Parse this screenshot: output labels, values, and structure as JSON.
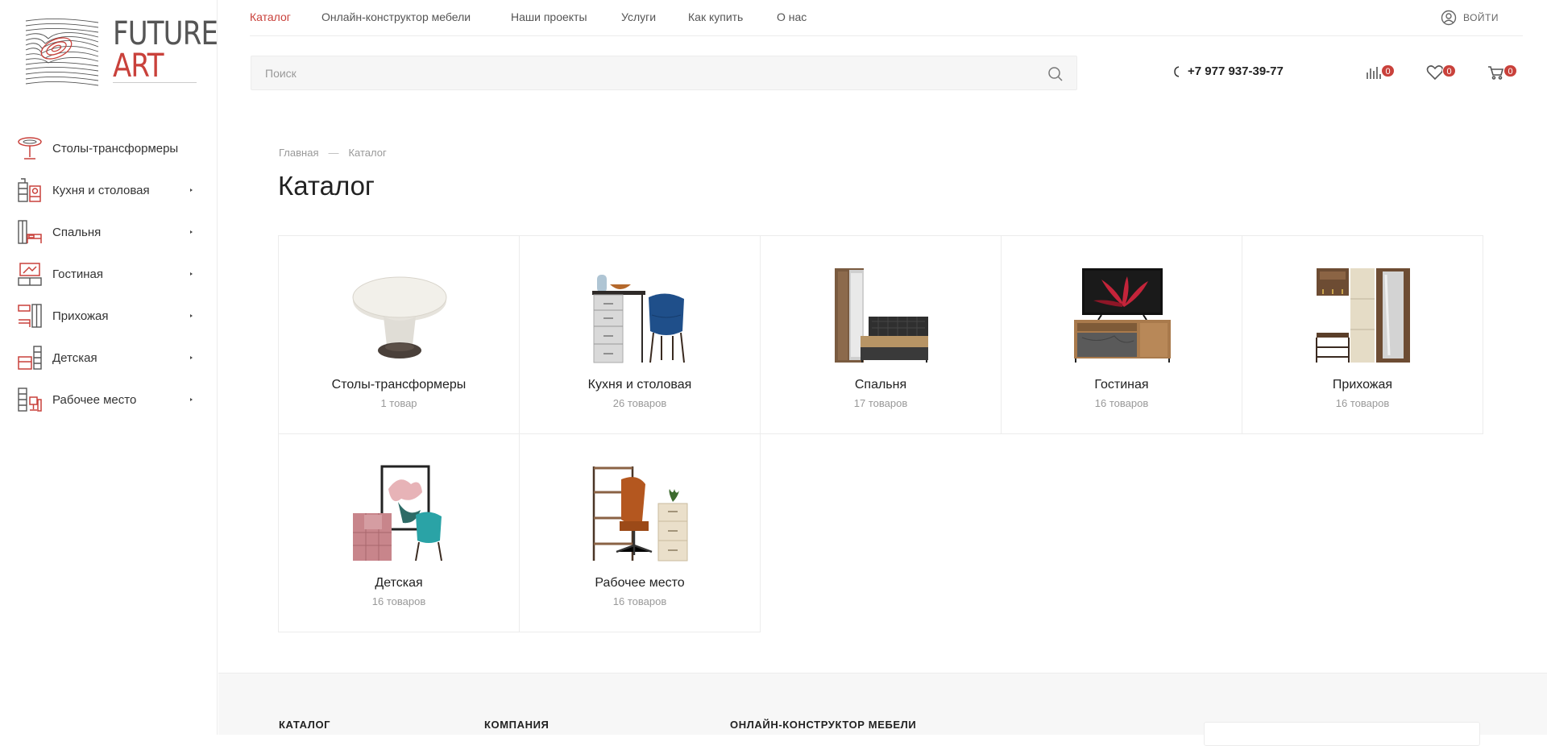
{
  "brand": {
    "line1": "FUTURE",
    "line2": "ART"
  },
  "sidebar": {
    "items": [
      {
        "label": "Столы-трансформеры",
        "icon": "round-table-icon",
        "has_submenu": false
      },
      {
        "label": "Кухня и столовая",
        "icon": "kitchen-icon",
        "has_submenu": true
      },
      {
        "label": "Спальня",
        "icon": "bedroom-icon",
        "has_submenu": true
      },
      {
        "label": "Гостиная",
        "icon": "living-room-icon",
        "has_submenu": true
      },
      {
        "label": "Прихожая",
        "icon": "hallway-icon",
        "has_submenu": true
      },
      {
        "label": "Детская",
        "icon": "kids-room-icon",
        "has_submenu": true
      },
      {
        "label": "Рабочее место",
        "icon": "workplace-icon",
        "has_submenu": true
      }
    ]
  },
  "topnav": {
    "items": [
      {
        "label": "Каталог",
        "active": true
      },
      {
        "label": "Онлайн-конструктор мебели",
        "active": false
      },
      {
        "label": "Наши проекты",
        "active": false
      },
      {
        "label": "Услуги",
        "active": false
      },
      {
        "label": "Как купить",
        "active": false
      },
      {
        "label": "О нас",
        "active": false
      }
    ],
    "login_label": "Войти"
  },
  "search": {
    "placeholder": "Поиск",
    "value": ""
  },
  "contacts": {
    "phone": "+7 977 937-39-77"
  },
  "header_counters": {
    "compare": "0",
    "favorites": "0",
    "cart": "0"
  },
  "breadcrumb": {
    "home": "Главная",
    "current": "Каталог"
  },
  "page": {
    "title": "Каталог"
  },
  "catalog": {
    "categories": [
      {
        "name": "Столы-трансформеры",
        "count": "1 товар",
        "icon": "round-table-image"
      },
      {
        "name": "Кухня и столовая",
        "count": "26 товаров",
        "icon": "kitchen-set-image"
      },
      {
        "name": "Спальня",
        "count": "17 товаров",
        "icon": "bedroom-set-image"
      },
      {
        "name": "Гостиная",
        "count": "16 товаров",
        "icon": "tv-stand-image"
      },
      {
        "name": "Прихожая",
        "count": "16 товаров",
        "icon": "hallway-wardrobe-image"
      },
      {
        "name": "Детская",
        "count": "16 товаров",
        "icon": "kids-furniture-image"
      },
      {
        "name": "Рабочее место",
        "count": "16 товаров",
        "icon": "office-set-image"
      }
    ]
  },
  "footer": {
    "headings": [
      "Каталог",
      "Компания",
      "Онлайн-конструктор мебели"
    ]
  },
  "colors": {
    "accent": "#c9413b",
    "text": "#333333",
    "muted": "#999999",
    "border": "#ececec"
  }
}
